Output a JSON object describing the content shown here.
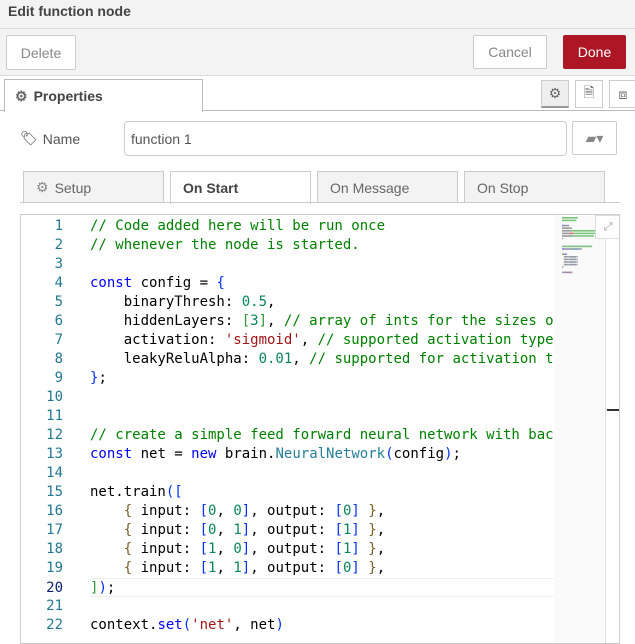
{
  "dialog": {
    "title": "Edit function node",
    "delete_label": "Delete",
    "cancel_label": "Cancel",
    "done_label": "Done",
    "done_color": "#ad1625"
  },
  "tabs": {
    "properties_label": "Properties",
    "icons": [
      "gear-icon",
      "file-text-icon",
      "frame-icon"
    ]
  },
  "name": {
    "label": "Name",
    "value": "function 1",
    "book_icon": "book-icon"
  },
  "subtabs": [
    {
      "label": "Setup"
    },
    {
      "label": "On Start",
      "active": true
    },
    {
      "label": "On Message"
    },
    {
      "label": "On Stop"
    }
  ],
  "editor": {
    "current_line": 20,
    "lines": [
      [
        [
          "c",
          "// Code added here will be run once"
        ]
      ],
      [
        [
          "c",
          "// whenever the node is started."
        ]
      ],
      [],
      [
        [
          "k",
          "const"
        ],
        [
          "t",
          " config = "
        ],
        [
          "b",
          "{"
        ]
      ],
      [
        [
          "t",
          "    binaryThresh: "
        ],
        [
          "n",
          "0.5"
        ],
        [
          "t",
          ","
        ]
      ],
      [
        [
          "t",
          "    hiddenLayers: "
        ],
        [
          "g",
          "["
        ],
        [
          "n",
          "3"
        ],
        [
          "g",
          "]"
        ],
        [
          "t",
          ", "
        ],
        [
          "c",
          "// array of ints for the sizes of the hidden layers in the network"
        ]
      ],
      [
        [
          "t",
          "    activation: "
        ],
        [
          "s",
          "'sigmoid'"
        ],
        [
          "t",
          ", "
        ],
        [
          "c",
          "// supported activation types: ['sigmoid', 'relu', 'leaky-relu', 'tanh']"
        ]
      ],
      [
        [
          "t",
          "    leakyReluAlpha: "
        ],
        [
          "n",
          "0.01"
        ],
        [
          "t",
          ", "
        ],
        [
          "c",
          "// supported for activation type 'leaky-relu'"
        ]
      ],
      [
        [
          "b",
          "}"
        ],
        [
          "t",
          ";"
        ]
      ],
      [],
      [],
      [
        [
          "c",
          "// create a simple feed forward neural network with backpropagation"
        ]
      ],
      [
        [
          "k",
          "const"
        ],
        [
          "t",
          " net = "
        ],
        [
          "k",
          "new"
        ],
        [
          "t",
          " brain."
        ],
        [
          "f",
          "NeuralNetwork"
        ],
        [
          "b",
          "("
        ],
        [
          "t",
          "config"
        ],
        [
          "b",
          ")"
        ],
        [
          "t",
          ";"
        ]
      ],
      [],
      [
        [
          "t",
          "net.train"
        ],
        [
          "b",
          "(["
        ]
      ],
      [
        [
          "t",
          "    "
        ],
        [
          "p",
          "{"
        ],
        [
          "t",
          " input: "
        ],
        [
          "b",
          "["
        ],
        [
          "n",
          "0"
        ],
        [
          "t",
          ", "
        ],
        [
          "n",
          "0"
        ],
        [
          "b",
          "]"
        ],
        [
          "t",
          ", output: "
        ],
        [
          "b",
          "["
        ],
        [
          "n",
          "0"
        ],
        [
          "b",
          "]"
        ],
        [
          "t",
          " "
        ],
        [
          "p",
          "}"
        ],
        [
          "t",
          ","
        ]
      ],
      [
        [
          "t",
          "    "
        ],
        [
          "p",
          "{"
        ],
        [
          "t",
          " input: "
        ],
        [
          "b",
          "["
        ],
        [
          "n",
          "0"
        ],
        [
          "t",
          ", "
        ],
        [
          "n",
          "1"
        ],
        [
          "b",
          "]"
        ],
        [
          "t",
          ", output: "
        ],
        [
          "b",
          "["
        ],
        [
          "n",
          "1"
        ],
        [
          "b",
          "]"
        ],
        [
          "t",
          " "
        ],
        [
          "p",
          "}"
        ],
        [
          "t",
          ","
        ]
      ],
      [
        [
          "t",
          "    "
        ],
        [
          "p",
          "{"
        ],
        [
          "t",
          " input: "
        ],
        [
          "b",
          "["
        ],
        [
          "n",
          "1"
        ],
        [
          "t",
          ", "
        ],
        [
          "n",
          "0"
        ],
        [
          "b",
          "]"
        ],
        [
          "t",
          ", output: "
        ],
        [
          "b",
          "["
        ],
        [
          "n",
          "1"
        ],
        [
          "b",
          "]"
        ],
        [
          "t",
          " "
        ],
        [
          "p",
          "}"
        ],
        [
          "t",
          ","
        ]
      ],
      [
        [
          "t",
          "    "
        ],
        [
          "p",
          "{"
        ],
        [
          "t",
          " input: "
        ],
        [
          "b",
          "["
        ],
        [
          "n",
          "1"
        ],
        [
          "t",
          ", "
        ],
        [
          "n",
          "1"
        ],
        [
          "b",
          "]"
        ],
        [
          "t",
          ", output: "
        ],
        [
          "b",
          "["
        ],
        [
          "n",
          "0"
        ],
        [
          "b",
          "]"
        ],
        [
          "t",
          " "
        ],
        [
          "p",
          "}"
        ],
        [
          "t",
          ","
        ]
      ],
      [
        [
          "g",
          "]"
        ],
        [
          "b",
          ")"
        ],
        [
          "t",
          ";"
        ]
      ],
      [],
      [
        [
          "t",
          "context."
        ],
        [
          "k",
          "set"
        ],
        [
          "b",
          "("
        ],
        [
          "s",
          "'net'"
        ],
        [
          "t",
          ", net"
        ],
        [
          "b",
          ")"
        ]
      ]
    ]
  }
}
